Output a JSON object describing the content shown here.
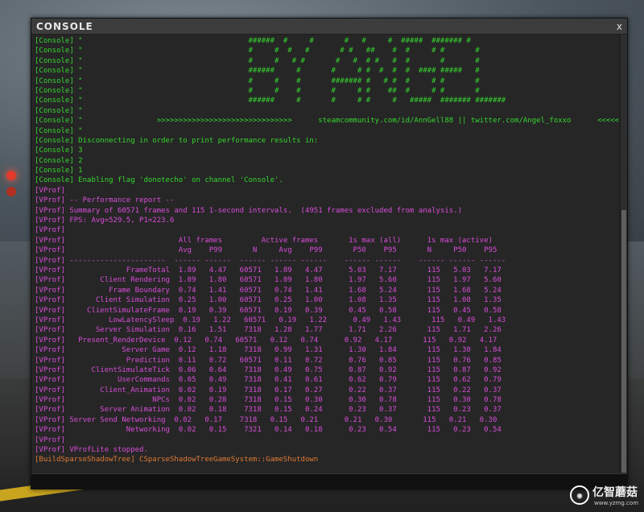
{
  "window": {
    "title": "CONSOLE",
    "close_label": "x"
  },
  "log_lines": [
    {
      "c": "g",
      "t": "[Console] \"                                      ######  #     #       #   #     #  #####  ####### #"
    },
    {
      "c": "g",
      "t": "[Console] \"                                      #     #  #   #       # #   ##    #  #     # #       #"
    },
    {
      "c": "g",
      "t": "[Console] \"                                      #     #   # #       #   #  # #   #  #       #       #"
    },
    {
      "c": "g",
      "t": "[Console] \"                                      ######     #       #     # #  #  #  #  #### #####   #"
    },
    {
      "c": "g",
      "t": "[Console] \"                                      #     #    #       ####### #   # #  #     # #       #"
    },
    {
      "c": "g",
      "t": "[Console] \"                                      #     #    #       #     # #    ##  #     # #       #"
    },
    {
      "c": "g",
      "t": "[Console] \"                                      ######     #       #     # #     #   #####  ####### #######"
    },
    {
      "c": "g",
      "t": "[Console] \""
    },
    {
      "c": "g",
      "t": "[Console] \"                 >>>>>>>>>>>>>>>>>>>>>>>>>>>>>>>      steamcommunity.com/id/AnnGell88 || twitter.com/Angel_foxxo      <<<<<<<<<<<<<<<<"
    },
    {
      "c": "g",
      "t": "[Console] \""
    },
    {
      "c": "g",
      "t": "[Console] Disconnecting in order to print performance results in:"
    },
    {
      "c": "g",
      "t": "[Console] 3"
    },
    {
      "c": "g",
      "t": "[Console] 2"
    },
    {
      "c": "g",
      "t": "[Console] 1"
    },
    {
      "c": "g",
      "t": "[Console] Enabling flag 'donotecho' on channel 'Console'."
    },
    {
      "c": "p",
      "t": "[VProf]"
    },
    {
      "c": "p",
      "t": "[VProf] -- Performance report --"
    },
    {
      "c": "p",
      "t": "[VProf] Summary of 60571 frames and 115 1-second intervals.  (4951 frames excluded from analysis.)"
    },
    {
      "c": "p",
      "t": "[VProf] FPS: Avg=529.5, P1=223.6"
    },
    {
      "c": "p",
      "t": "[VProf]"
    },
    {
      "c": "p",
      "t": "[VProf]                          All frames         Active frames       1s max (all)      1s max (active)"
    },
    {
      "c": "p",
      "t": "[VProf]                          Avg    P99       N     Avg    P99       P50    P95       N     P50    P95"
    },
    {
      "c": "p",
      "t": "[VProf] ----------------------  ------ ------  ------ ------ ------    ------ ------    ------ ------ ------"
    },
    {
      "c": "p",
      "t": "[VProf]              FrameTotal  1.89   4.47   60571   1.89   4.47      5.03   7.17       115   5.03   7.17"
    },
    {
      "c": "p",
      "t": "[VProf]        Client Rendering  1.09   1.80   60571   1.09   1.80      1.97   5.60       115   1.97   5.60"
    },
    {
      "c": "p",
      "t": "[VProf]          Frame Boundary  0.74   1.41   60571   0.74   1.41      1.68   5.24       115   1.68   5.24"
    },
    {
      "c": "p",
      "t": "[VProf]       Client Simulation  0.25   1.00   60571   0.25   1.00      1.08   1.35       115   1.08   1.35"
    },
    {
      "c": "p",
      "t": "[VProf]     ClientSimulateFrame  0.19   0.39   60571   0.19   0.39      0.45   0.58       115   0.45   0.58"
    },
    {
      "c": "p",
      "t": "[VProf]          LowLatencySleep  0.19   1.22   60571   0.19   1.22      0.49   1.43       115   0.49   1.43"
    },
    {
      "c": "p",
      "t": "[VProf]       Server Simulation  0.16   1.51    7318   1.28   1.77      1.71   2.26       115   1.71   2.26"
    },
    {
      "c": "p",
      "t": "[VProf]   Present_RenderDevice  0.12   0.74   60571   0.12   0.74      0.92   4.17       115   0.92   4.17"
    },
    {
      "c": "p",
      "t": "[VProf]             Server Game  0.12   1.18    7318   0.99   1.31      1.30   1.84       115   1.30   1.84"
    },
    {
      "c": "p",
      "t": "[VProf]              Prediction  0.11   0.72   60571   0.11   0.72      0.76   0.85       115   0.76   0.85"
    },
    {
      "c": "p",
      "t": "[VProf]      ClientSimulateTick  0.06   0.64    7318   0.49   0.75      0.87   0.92       115   0.87   0.92"
    },
    {
      "c": "p",
      "t": "[VProf]            UserCommands  0.05   0.49    7318   0.41   0.61      0.62   0.79       115   0.62   0.79"
    },
    {
      "c": "p",
      "t": "[VProf]        Client_Animation  0.02   0.19    7318   0.17   0.27      0.22   0.37       115   0.22   0.37"
    },
    {
      "c": "p",
      "t": "[VProf]                    NPCs  0.02   0.28    7318   0.15   0.30      0.30   0.78       115   0.30   0.78"
    },
    {
      "c": "p",
      "t": "[VProf]        Server Animation  0.02   0.18    7318   0.15   0.24      0.23   0.37       115   0.23   0.37"
    },
    {
      "c": "p",
      "t": "[VProf] Server Send Networking  0.02   0.17    7318   0.15   0.21      0.21   0.30       115   0.21   0.30"
    },
    {
      "c": "p",
      "t": "[VProf]              Networking  0.02   0.15    7321   0.14   0.18      0.23   0.54       115   0.23   0.54"
    },
    {
      "c": "p",
      "t": "[VProf]"
    },
    {
      "c": "p",
      "t": "[VProf] VProfLite stopped."
    },
    {
      "c": "o",
      "t": "[BuildSparseShadowTree] CSparseShadowTreeGameSystem::GameShutdown"
    }
  ],
  "watermark": {
    "text": "亿智蘑菇",
    "sub": "www.yzmg.com"
  }
}
